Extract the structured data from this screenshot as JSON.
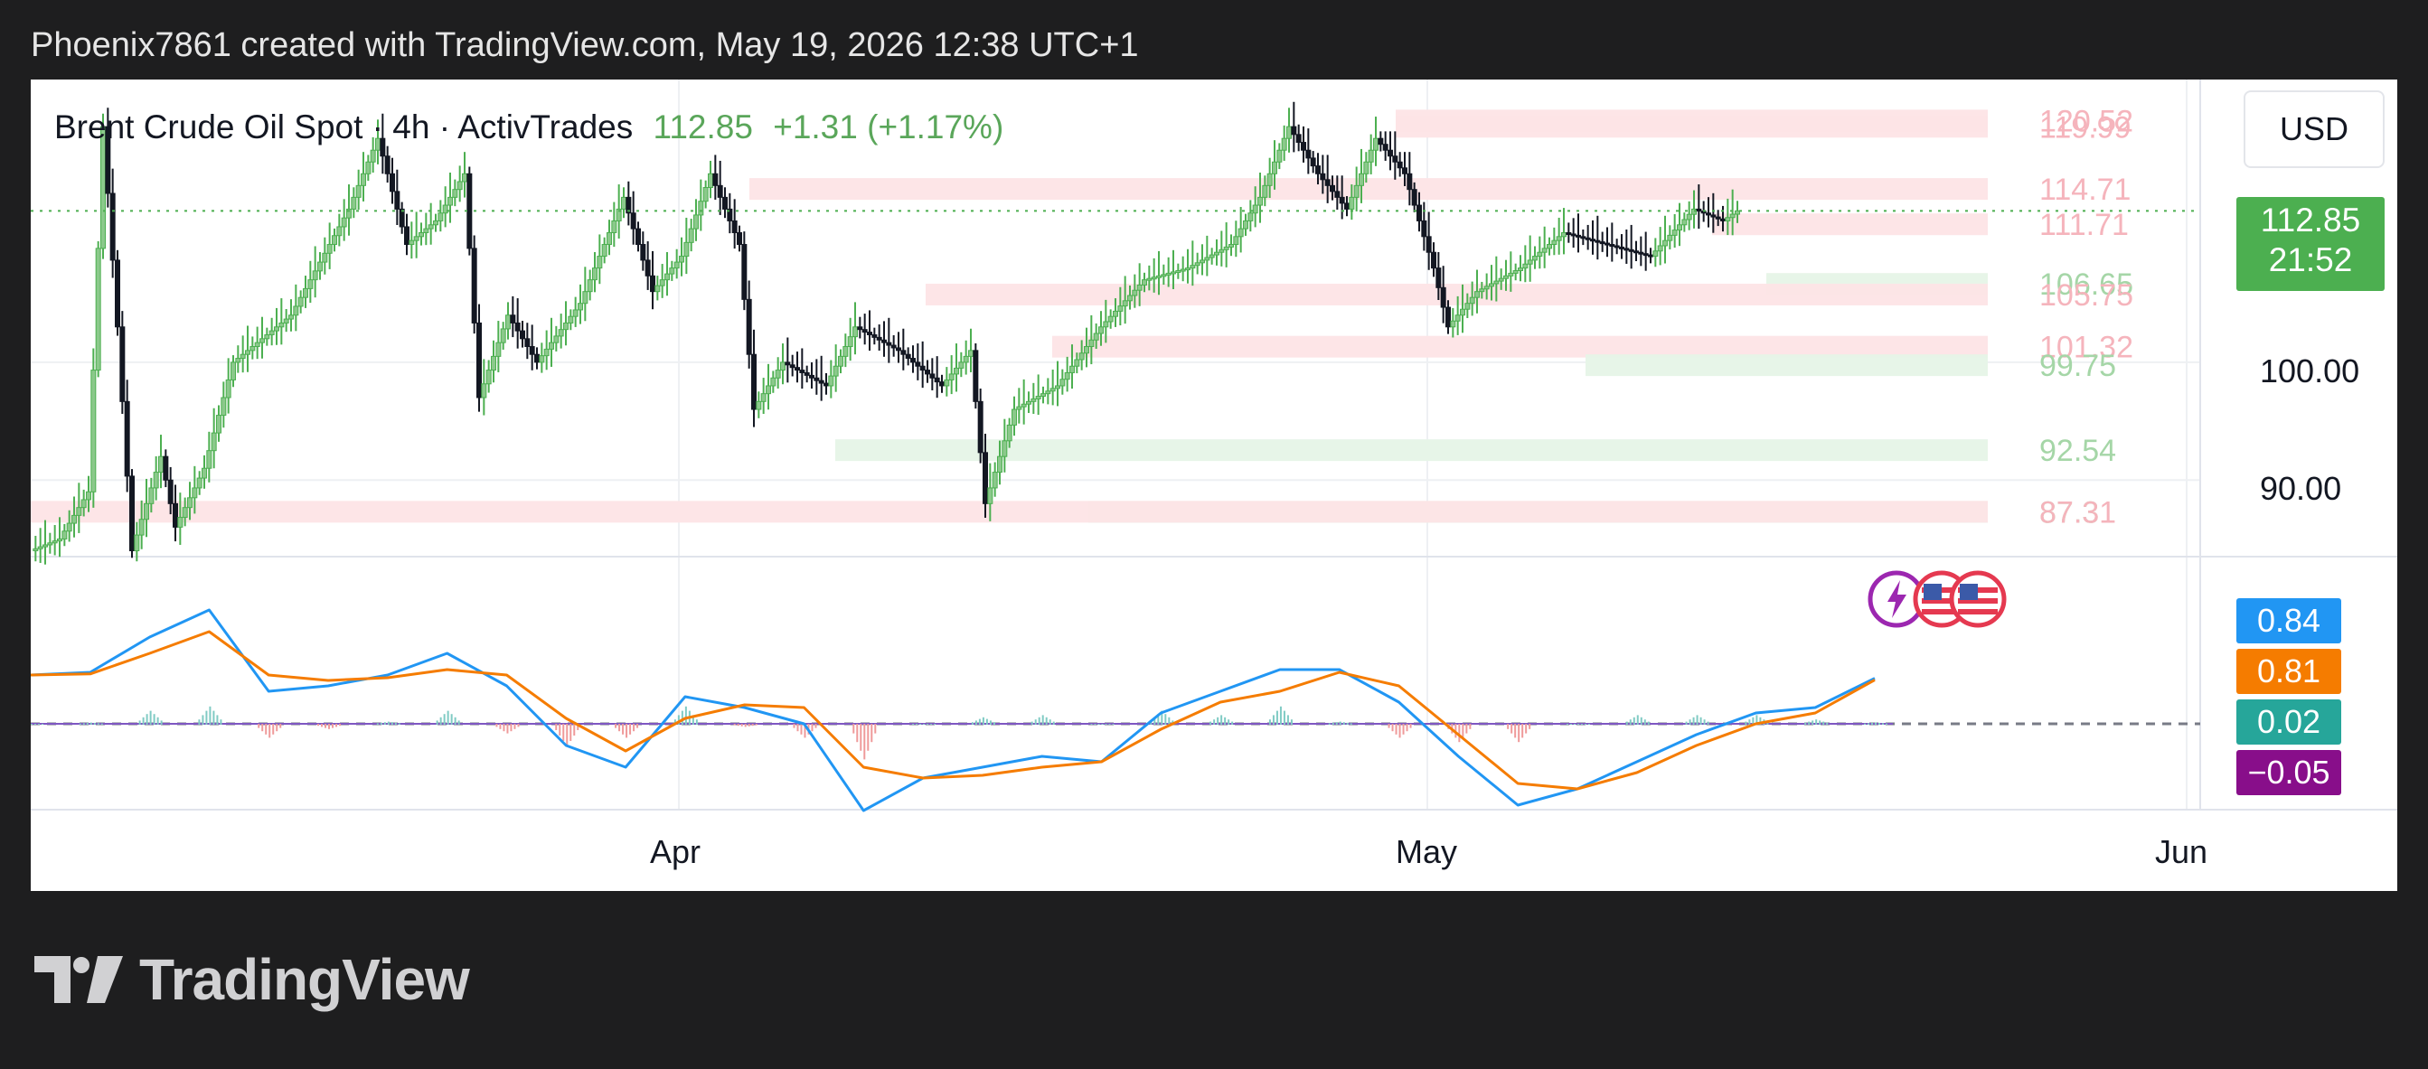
{
  "header": {
    "attribution": "Phoenix7861 created with TradingView.com, May 19, 2026 12:38 UTC+1"
  },
  "legend": {
    "symbol": "Brent Crude Oil Spot · 4h · ActivTrades",
    "price": "112.85",
    "change": "+1.31 (+1.17%)"
  },
  "currency_button": "USD",
  "price_tag": {
    "price": "112.85",
    "countdown": "21:52"
  },
  "macd_tags": [
    {
      "value": "0.84",
      "color": "#2196f3"
    },
    {
      "value": "0.81",
      "color": "#f57c00"
    },
    {
      "value": "0.02",
      "color": "#26a69a"
    },
    {
      "value": "−0.05",
      "color": "#880e8a"
    }
  ],
  "brand": {
    "name": "TradingView"
  },
  "chart_data": {
    "type": "line",
    "title": "Brent Crude Oil Spot · 4h · ActivTrades",
    "x_ticks": [
      "Apr",
      "May",
      "Jun"
    ],
    "y_ticks": [
      "100.00",
      "90.00"
    ],
    "y_range": [
      83.5,
      124
    ],
    "last_price": 112.85,
    "levels": [
      {
        "label": "120.52",
        "value": 120.52,
        "kind": "resistance"
      },
      {
        "label": "119.99",
        "value": 119.99,
        "kind": "resistance"
      },
      {
        "label": "114.71",
        "value": 114.71,
        "kind": "resistance"
      },
      {
        "label": "111.71",
        "value": 111.71,
        "kind": "resistance"
      },
      {
        "label": "106.65",
        "value": 106.65,
        "kind": "support"
      },
      {
        "label": "105.75",
        "value": 105.75,
        "kind": "resistance"
      },
      {
        "label": "101.32",
        "value": 101.32,
        "kind": "resistance"
      },
      {
        "label": "99.75",
        "value": 99.75,
        "kind": "support"
      },
      {
        "label": "92.54",
        "value": 92.54,
        "kind": "support"
      },
      {
        "label": "87.3",
        "value": 87.3,
        "kind": "support"
      },
      {
        "label": "87.31",
        "value": 87.31,
        "kind": "resistance"
      }
    ],
    "price_path": [
      {
        "t": 0,
        "p": 84
      },
      {
        "t": 2,
        "p": 85
      },
      {
        "t": 4,
        "p": 89
      },
      {
        "t": 5,
        "p": 120
      },
      {
        "t": 6,
        "p": 103
      },
      {
        "t": 7,
        "p": 84
      },
      {
        "t": 9,
        "p": 92
      },
      {
        "t": 10,
        "p": 86
      },
      {
        "t": 12,
        "p": 91
      },
      {
        "t": 14,
        "p": 100
      },
      {
        "t": 18,
        "p": 104
      },
      {
        "t": 22,
        "p": 113
      },
      {
        "t": 24,
        "p": 119
      },
      {
        "t": 26,
        "p": 110
      },
      {
        "t": 28,
        "p": 112
      },
      {
        "t": 30,
        "p": 116
      },
      {
        "t": 31,
        "p": 97
      },
      {
        "t": 33,
        "p": 104
      },
      {
        "t": 35,
        "p": 100
      },
      {
        "t": 38,
        "p": 105
      },
      {
        "t": 41,
        "p": 114
      },
      {
        "t": 43,
        "p": 106
      },
      {
        "t": 45,
        "p": 109
      },
      {
        "t": 47,
        "p": 116
      },
      {
        "t": 49,
        "p": 110
      },
      {
        "t": 50,
        "p": 96
      },
      {
        "t": 52,
        "p": 100
      },
      {
        "t": 55,
        "p": 98
      },
      {
        "t": 57,
        "p": 103
      },
      {
        "t": 60,
        "p": 101
      },
      {
        "t": 63,
        "p": 98
      },
      {
        "t": 65,
        "p": 101
      },
      {
        "t": 66,
        "p": 88
      },
      {
        "t": 68,
        "p": 96
      },
      {
        "t": 71,
        "p": 98
      },
      {
        "t": 74,
        "p": 103
      },
      {
        "t": 77,
        "p": 107
      },
      {
        "t": 80,
        "p": 108
      },
      {
        "t": 83,
        "p": 110
      },
      {
        "t": 85,
        "p": 114
      },
      {
        "t": 87,
        "p": 120
      },
      {
        "t": 89,
        "p": 116
      },
      {
        "t": 91,
        "p": 113
      },
      {
        "t": 93,
        "p": 119
      },
      {
        "t": 95,
        "p": 116
      },
      {
        "t": 97,
        "p": 108
      },
      {
        "t": 98,
        "p": 103
      },
      {
        "t": 100,
        "p": 106
      },
      {
        "t": 103,
        "p": 108
      },
      {
        "t": 106,
        "p": 111
      },
      {
        "t": 109,
        "p": 110
      },
      {
        "t": 112,
        "p": 109
      },
      {
        "t": 115,
        "p": 113
      },
      {
        "t": 117,
        "p": 112
      },
      {
        "t": 118,
        "p": 112.85
      }
    ],
    "macd": {
      "series": [
        {
          "name": "MACD",
          "values": [
            0.9,
            0.95,
            1.6,
            2.1,
            0.6,
            0.7,
            0.9,
            1.3,
            0.7,
            -0.4,
            -0.8,
            0.5,
            0.3,
            0.0,
            -1.6,
            -1.0,
            -0.8,
            -0.6,
            -0.7,
            0.2,
            0.6,
            1.0,
            1.0,
            0.4,
            -0.6,
            -1.5,
            -1.2,
            -0.7,
            -0.2,
            0.2,
            0.3,
            0.84
          ]
        },
        {
          "name": "Signal",
          "values": [
            0.9,
            0.92,
            1.3,
            1.7,
            0.9,
            0.8,
            0.85,
            1.0,
            0.9,
            0.1,
            -0.5,
            0.1,
            0.35,
            0.3,
            -0.8,
            -1.0,
            -0.95,
            -0.8,
            -0.7,
            -0.1,
            0.4,
            0.6,
            0.95,
            0.7,
            -0.2,
            -1.1,
            -1.2,
            -0.9,
            -0.4,
            0.0,
            0.2,
            0.81
          ]
        }
      ]
    }
  }
}
